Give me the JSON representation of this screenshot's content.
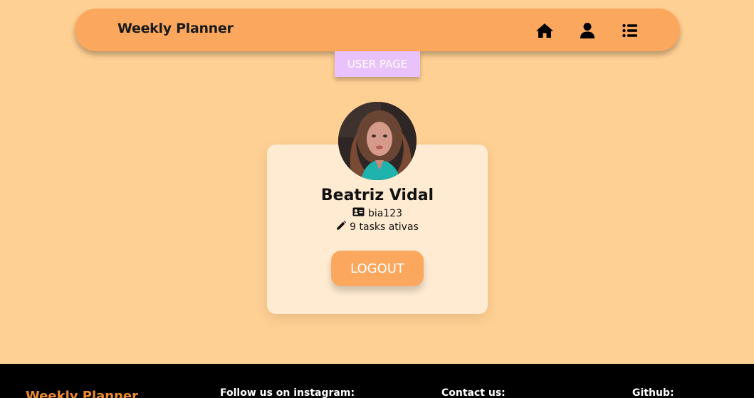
{
  "header": {
    "brand": "Weekly Planner",
    "icons": [
      "home-icon",
      "user-icon",
      "list-icon"
    ]
  },
  "page_tab": {
    "label": "USER PAGE"
  },
  "profile": {
    "name": "Beatriz Vidal",
    "username": "bia123",
    "tasks_text": "9 tasks ativas",
    "logout_label": "LOGOUT"
  },
  "footer": {
    "brand": "Weekly Planner",
    "instagram_heading": "Follow us on instagram:",
    "contact_heading": "Contact us:",
    "github_heading": "Github:"
  },
  "colors": {
    "background": "#ffd093",
    "navbar": "#fba85e",
    "tab": "#e9c2fb",
    "card": "#ffebd2",
    "footer": "#000000",
    "footer_brand": "#f08a2c"
  }
}
